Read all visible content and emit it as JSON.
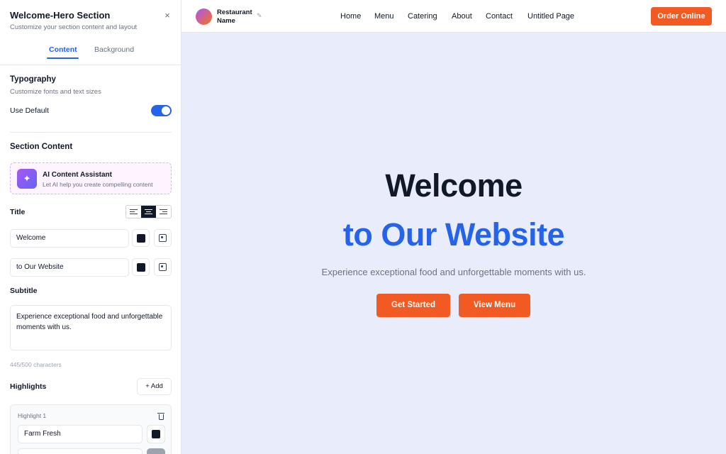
{
  "panel": {
    "title": "Welcome-Hero Section",
    "subtitle": "Customize your section content and layout",
    "close_label": "×",
    "tabs": [
      {
        "label": "Content",
        "active": true
      },
      {
        "label": "Background",
        "active": false
      }
    ]
  },
  "typography": {
    "title": "Typography",
    "subtitle": "Customize fonts and text sizes",
    "use_default_label": "Use Default",
    "use_default_on": true
  },
  "section_content": {
    "title": "Section Content",
    "ai_assistant": {
      "icon": "sparkle-icon",
      "title": "AI Content Assistant",
      "subtitle": "Let AI help you create compelling content"
    },
    "title_label": "Title",
    "title_alignment_selected": "center",
    "title_lines": [
      {
        "value": "Welcome",
        "color": "#111827"
      },
      {
        "value": "to Our Website",
        "color": "#111827"
      }
    ],
    "subtitle_label": "Subtitle",
    "subtitle_value": "Experience exceptional food and unforgettable moments with us.",
    "char_count": "445/500 characters",
    "highlights_label": "Highlights",
    "add_label": "+ Add",
    "highlights": [
      {
        "label": "Highlight 1",
        "value": "Farm Fresh",
        "color": "#111827"
      }
    ]
  },
  "preview": {
    "brand_name": "Restaurant Name",
    "edit_icon": "✎",
    "nav_links": [
      "Home",
      "Menu",
      "Catering",
      "About",
      "Contact",
      "Untitled Page"
    ],
    "cta_label": "Order Online",
    "hero": {
      "line1": "Welcome",
      "line2": "to Our Website",
      "subtitle": "Experience exceptional food and unforgettable moments with us.",
      "buttons": [
        "Get Started",
        "View Menu"
      ]
    }
  },
  "colors": {
    "accent_blue": "#2563eb",
    "cta_orange": "#f15a22",
    "preview_bg": "#e9edfb"
  }
}
